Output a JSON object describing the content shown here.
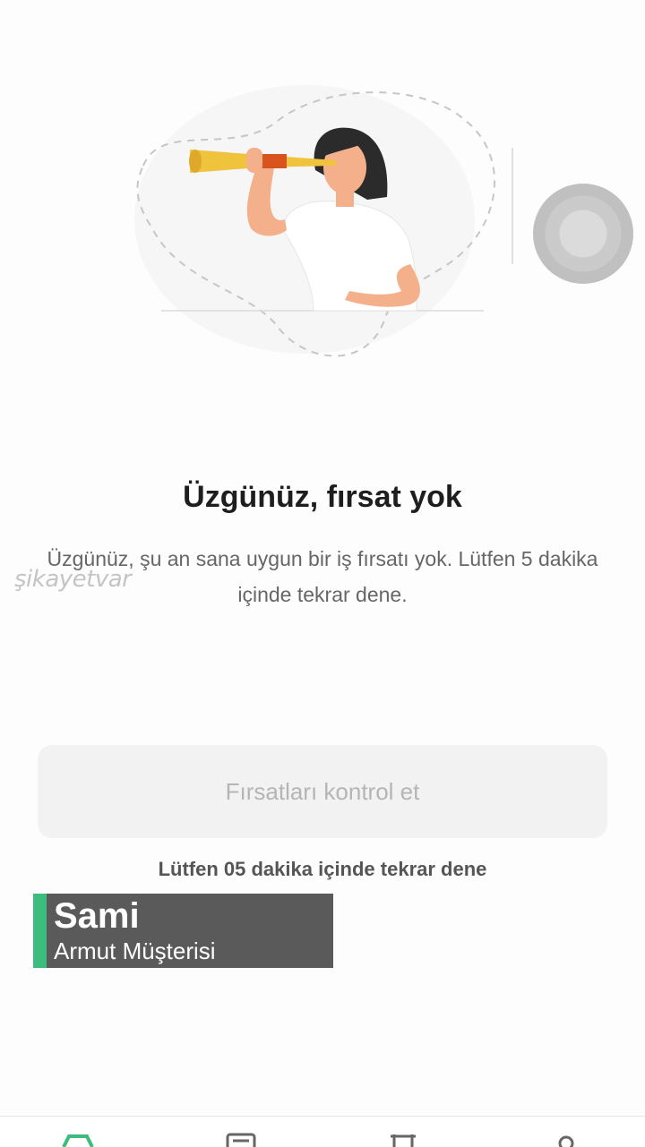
{
  "empty_state": {
    "title": "Üzgünüz, fırsat yok",
    "message": "Üzgünüz, şu an sana uygun bir iş fırsatı yok. Lütfen 5 dakika içinde tekrar dene."
  },
  "actions": {
    "check_button_label": "Fırsatları kontrol et",
    "retry_hint": "Lütfen 05 dakika içinde tekrar dene"
  },
  "watermark": {
    "text": "şikayetvar"
  },
  "caption": {
    "name": "Sami",
    "role": "Armut Müşterisi",
    "accent_color": "#3dbd7d"
  },
  "bottom_nav": {
    "items": [
      {
        "icon": "home-icon"
      },
      {
        "icon": "document-icon"
      },
      {
        "icon": "trophy-icon"
      },
      {
        "icon": "user-icon"
      }
    ],
    "active_color": "#3dbd7d"
  }
}
